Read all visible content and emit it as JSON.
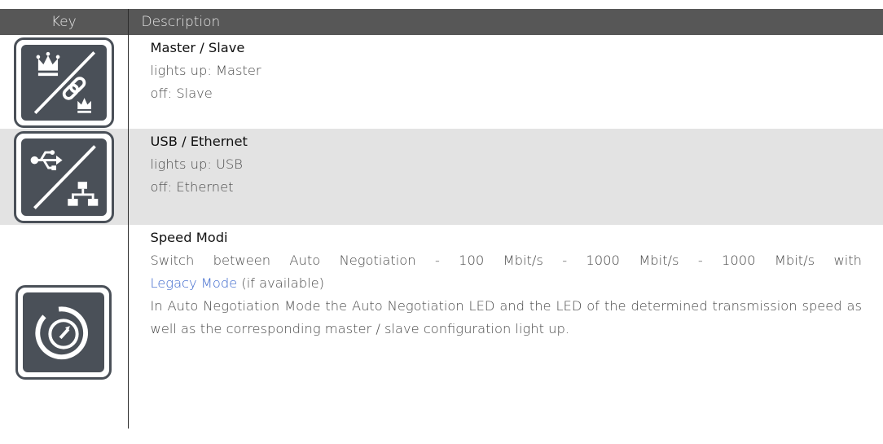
{
  "table": {
    "caption_fragment": "",
    "header": {
      "key": "Key",
      "description": "Description"
    },
    "rows": [
      {
        "icon": "master-slave-icon",
        "title": "Master / Slave",
        "lines": [
          "lights up: Master",
          "off: Slave"
        ]
      },
      {
        "icon": "usb-ethernet-icon",
        "title": "USB / Ethernet",
        "lines": [
          "lights up: USB",
          "off: Ethernet"
        ]
      },
      {
        "icon": "speed-modi-icon",
        "title": "Speed Modi",
        "line1_pre": "Switch between Auto Negotiation - 100 Mbit/s - 1000 Mbit/s - 1000 Mbit/s with",
        "line1_link": "Legacy Mode",
        "line1_post": " (if available)",
        "line2": "In Auto Negotiation Mode the Auto Negotiation LED and the LED of the determined transmission speed as well as the corresponding master / slave configuration light up."
      }
    ]
  },
  "colors": {
    "header_bg": "#575757",
    "shaded_row": "#e3e3e3",
    "icon_fill": "#4a5058",
    "link": "#3a66cc"
  }
}
